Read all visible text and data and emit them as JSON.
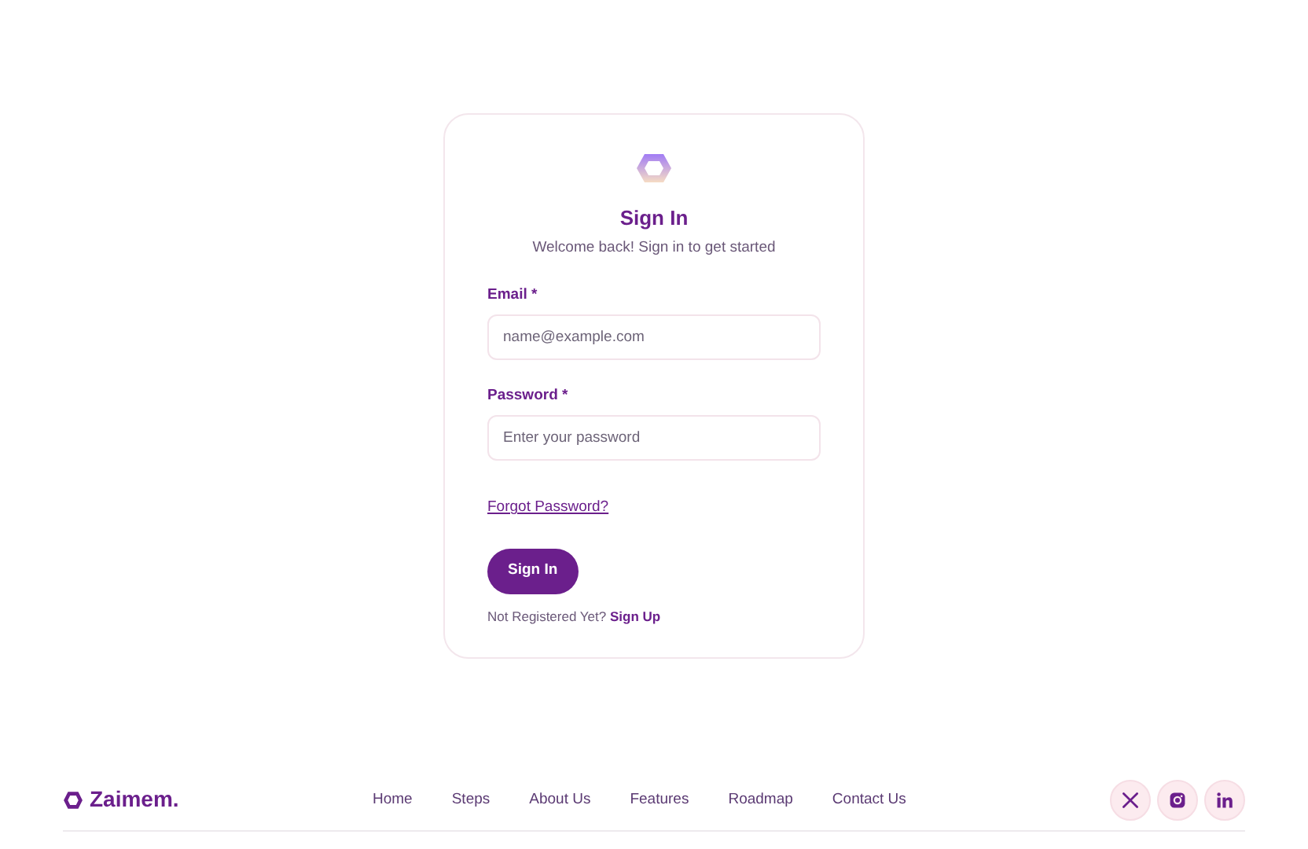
{
  "signin": {
    "title": "Sign In",
    "subtitle": "Welcome back! Sign in to get started",
    "fields": [
      {
        "label": "Email",
        "required_mark": "*",
        "placeholder": "name@example.com"
      },
      {
        "label": "Password",
        "required_mark": "*",
        "placeholder": "Enter your password"
      }
    ],
    "forgot_link": "Forgot Password?",
    "submit": "Sign In",
    "register_prompt": "Not Registered Yet?",
    "register_link": "Sign Up"
  },
  "footer": {
    "brand": "Zaimem.",
    "nav": [
      "Home",
      "Steps",
      "About Us",
      "Features",
      "Roadmap",
      "Contact Us"
    ],
    "social": [
      {
        "kind": "x"
      },
      {
        "kind": "instagram"
      },
      {
        "kind": "linkedin"
      }
    ]
  }
}
